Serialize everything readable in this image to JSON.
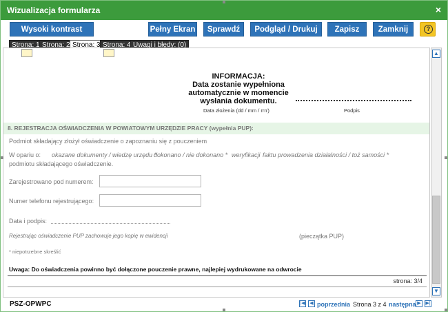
{
  "window": {
    "title": "Wizualizacja formularza",
    "close_glyph": "×"
  },
  "toolbar": {
    "high_contrast": "Wysoki kontrast",
    "fullscreen": "Pełny Ekran",
    "check": "Sprawdź",
    "preview_print": "Podgląd / Drukuj",
    "save": "Zapisz",
    "close": "Zamknij",
    "help_glyph": "?"
  },
  "tabs": [
    "Strona: 1",
    "Strona: 2",
    "Strona: 3",
    "Strona: 4",
    "Uwagi i błędy: (0)"
  ],
  "active_tab": "Strona: 3",
  "document": {
    "info_heading": "INFORMACJA:",
    "info_body": [
      "Data zostanie wypełniona",
      "automatycznie w momencie",
      "wysłania dokumentu."
    ],
    "date_label": "Data złożenia (dd / mm / rrrr)",
    "signature_label": "Podpis",
    "section_title": "8. REJESTRACJA OŚWIADCZENIA W POWIATOWYM URZĘDZIE PRACY (wypełnia PUP):",
    "declaration_line": "Podmiot składający złożył oświadczenie o zapoznaniu się z pouczeniem",
    "opinion_prefix": "W opariu o:",
    "opinion_items": [
      "okazane dokumenty / wiedzę urzędu *",
      "dokonano / nie dokonano *",
      "weryfikacji",
      "faktu prowadzenia działalności / toż samości *"
    ],
    "opinion_suffix": "podmiotu składającego oświadczenie.",
    "registered_label": "Zarejestrowano pod numerem:",
    "registered_value": "",
    "phone_label": "Numer telefonu rejestrującego:",
    "phone_value": "",
    "date_sign_label": "Data i podpis:",
    "registration_note": "Rejestrując oświadczenie PUP zachowuje jego kopię w ewidencji",
    "stamp_label": "(pieczątka PUP)",
    "footnote": "* niepotrzebne skreślić",
    "uwaga": "Uwaga: Do oświadczenia powinno być dołączone pouczenie prawne, najlepiej wydrukowane na odwrocie",
    "page_indicator": "strona: 3/4"
  },
  "footer": {
    "form_code": "PSZ-OPWPC",
    "prev_label": "poprzednia",
    "page_status": "Strona 3 z 4",
    "next_label": "następna"
  },
  "colors": {
    "titlebar": "#3c9b3c",
    "button": "#2e73b8",
    "help": "#f3c524",
    "section_bg": "#e6f5e6"
  }
}
